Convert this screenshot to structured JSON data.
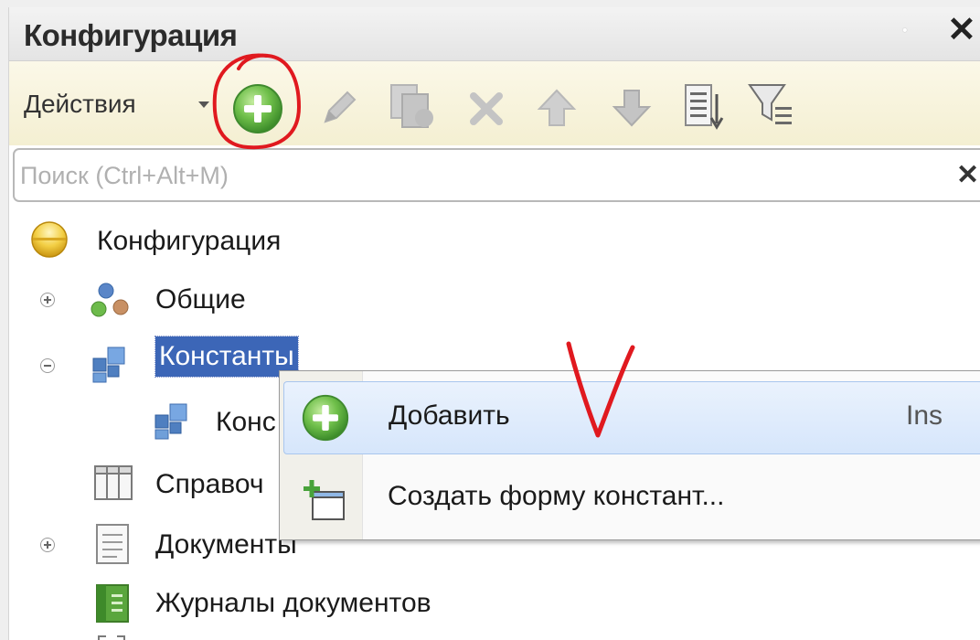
{
  "panel": {
    "title": "Конфигурация",
    "close_glyph": "✕",
    "pin_glyph": "⸳"
  },
  "toolbar": {
    "actions_label": "Действия",
    "icons": [
      "add-icon",
      "edit-icon",
      "copy-icon",
      "delete-icon",
      "move-up-icon",
      "move-down-icon",
      "sort-list-icon",
      "filter-icon"
    ]
  },
  "search": {
    "placeholder": "Поиск (Ctrl+Alt+M)",
    "value": "",
    "clear_glyph": "✕"
  },
  "tree": {
    "root_label": "Конфигурация",
    "items": [
      {
        "label": "Общие",
        "expander": "plus",
        "icon": "common-objects-icon"
      },
      {
        "label": "Константы",
        "expander": "minus",
        "icon": "constants-icon",
        "selected": true
      },
      {
        "label": "Конс",
        "icon": "constant-icon"
      },
      {
        "label": "Справоч",
        "icon": "catalogs-icon"
      },
      {
        "label": "Документы",
        "expander": "plus",
        "icon": "documents-icon"
      },
      {
        "label": "Журналы документов",
        "icon": "document-journals-icon"
      }
    ]
  },
  "context_menu": {
    "items": [
      {
        "label": "Добавить",
        "shortcut": "Ins",
        "icon": "add-icon",
        "highlighted": true
      },
      {
        "label": "Создать форму констант...",
        "icon": "create-form-icon"
      }
    ]
  },
  "colors": {
    "selection": "#3c66b7",
    "annotation": "#e0191f",
    "add_green": "#5aa63d"
  }
}
